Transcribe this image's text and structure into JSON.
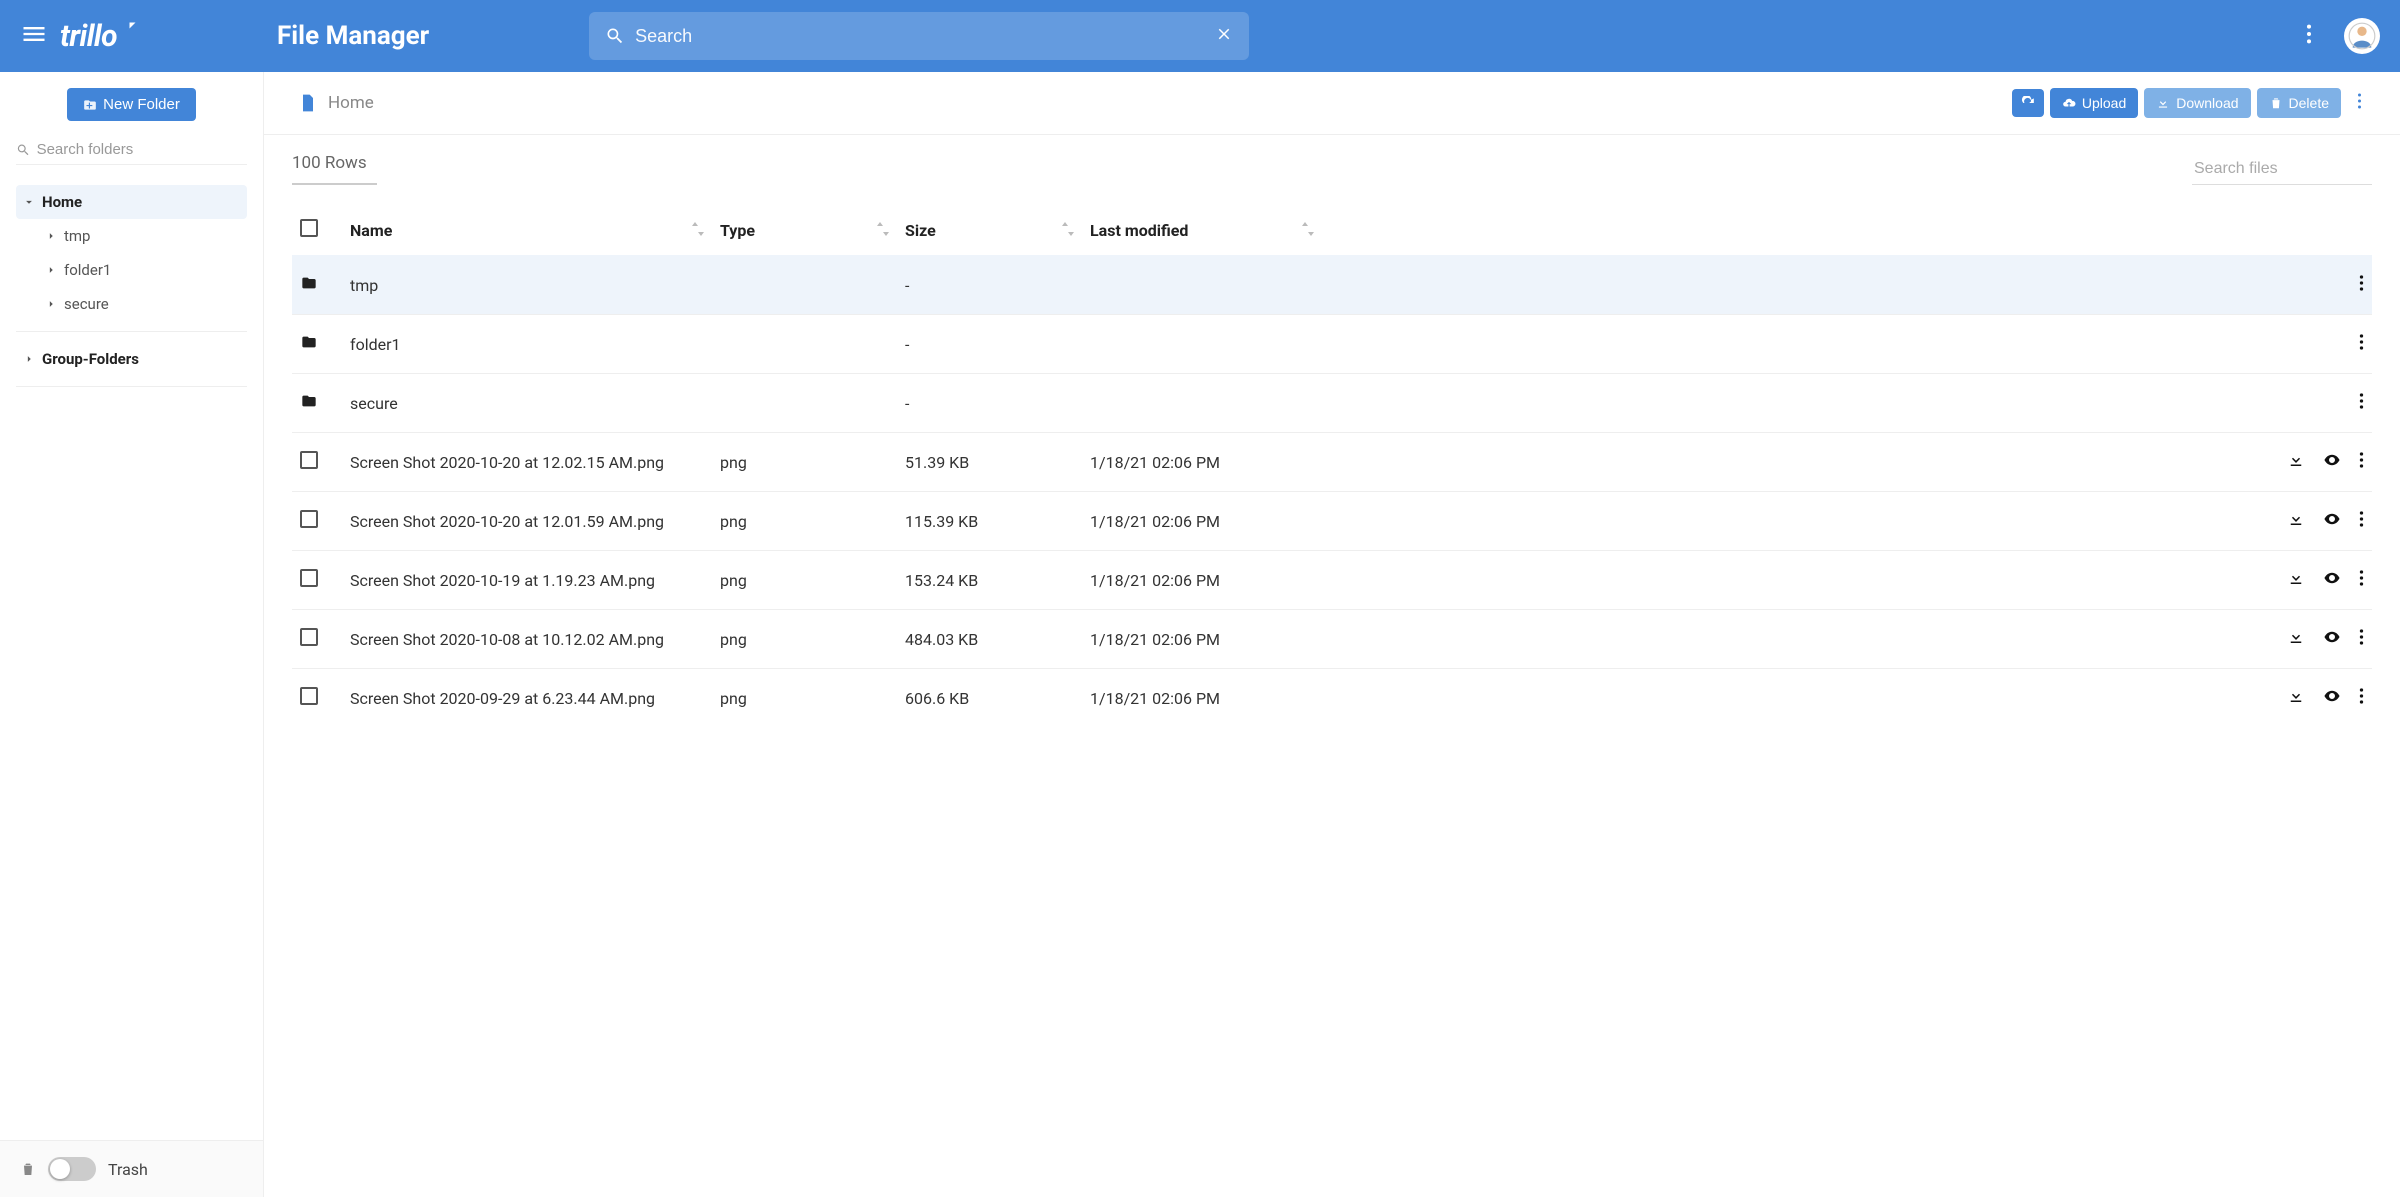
{
  "header": {
    "logo": "trillo",
    "title": "File Manager",
    "search_placeholder": "Search"
  },
  "sidebar": {
    "new_folder_label": "New Folder",
    "search_placeholder": "Search folders",
    "tree": {
      "home_label": "Home",
      "children": [
        {
          "label": "tmp"
        },
        {
          "label": "folder1"
        },
        {
          "label": "secure"
        }
      ],
      "group_label": "Group-Folders"
    },
    "trash_label": "Trash"
  },
  "toolbar": {
    "breadcrumb": "Home",
    "upload_label": "Upload",
    "download_label": "Download",
    "delete_label": "Delete"
  },
  "table": {
    "rows_label": "100 Rows",
    "search_files_placeholder": "Search files",
    "columns": {
      "name": "Name",
      "type": "Type",
      "size": "Size",
      "modified": "Last modified"
    },
    "rows": [
      {
        "is_folder": true,
        "name": "tmp",
        "type": "",
        "size": "-",
        "modified": ""
      },
      {
        "is_folder": true,
        "name": "folder1",
        "type": "",
        "size": "-",
        "modified": ""
      },
      {
        "is_folder": true,
        "name": "secure",
        "type": "",
        "size": "-",
        "modified": ""
      },
      {
        "is_folder": false,
        "name": "Screen Shot 2020-10-20 at 12.02.15 AM.png",
        "type": "png",
        "size": "51.39 KB",
        "modified": "1/18/21 02:06 PM"
      },
      {
        "is_folder": false,
        "name": "Screen Shot 2020-10-20 at 12.01.59 AM.png",
        "type": "png",
        "size": "115.39 KB",
        "modified": "1/18/21 02:06 PM"
      },
      {
        "is_folder": false,
        "name": "Screen Shot 2020-10-19 at 1.19.23 AM.png",
        "type": "png",
        "size": "153.24 KB",
        "modified": "1/18/21 02:06 PM"
      },
      {
        "is_folder": false,
        "name": "Screen Shot 2020-10-08 at 10.12.02 AM.png",
        "type": "png",
        "size": "484.03 KB",
        "modified": "1/18/21 02:06 PM"
      },
      {
        "is_folder": false,
        "name": "Screen Shot 2020-09-29 at 6.23.44 AM.png",
        "type": "png",
        "size": "606.6 KB",
        "modified": "1/18/21 02:06 PM"
      }
    ]
  }
}
